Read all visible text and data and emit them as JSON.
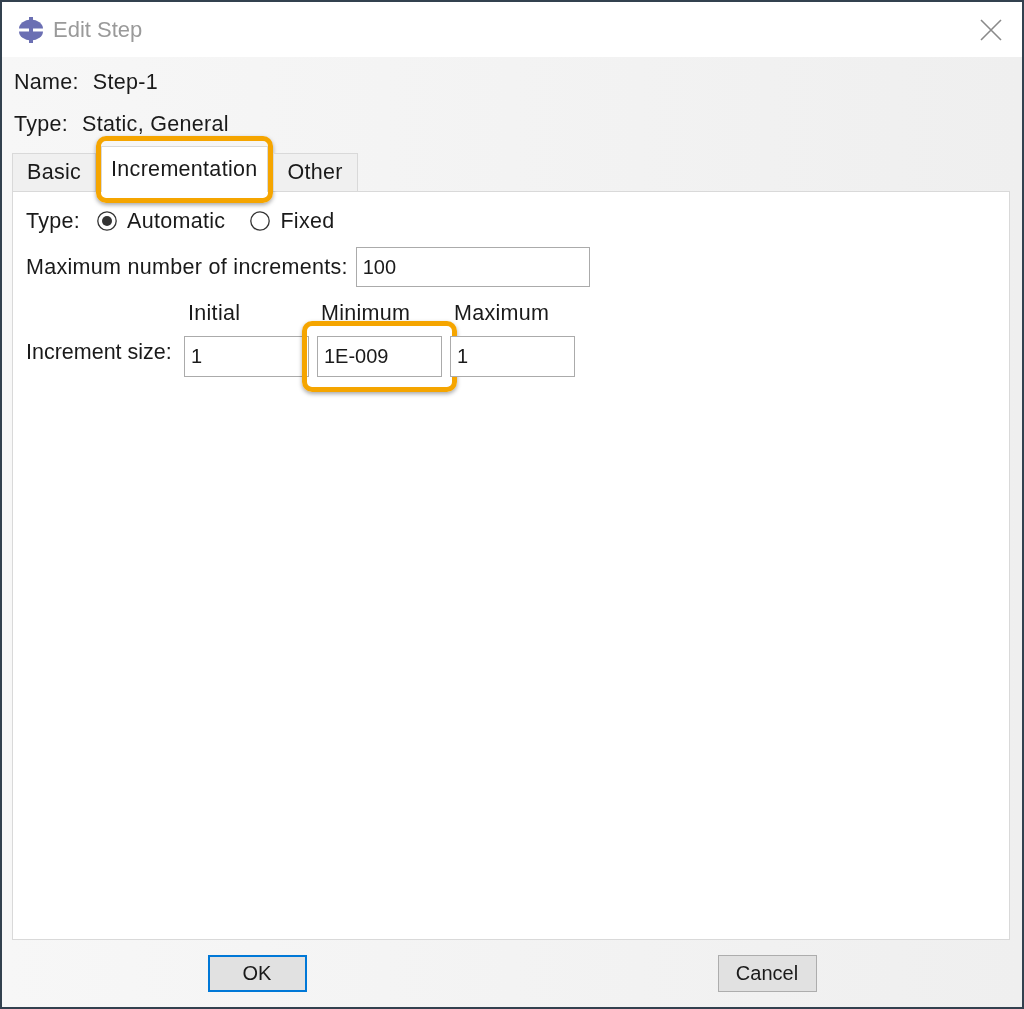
{
  "window": {
    "title": "Edit Step"
  },
  "info": [
    {
      "label": "Name:",
      "value": "Step-1"
    },
    {
      "label": "Type:",
      "value": "Static, General"
    }
  ],
  "tabs": [
    {
      "label": "Basic",
      "selected": false,
      "highlighted": false
    },
    {
      "label": "Incrementation",
      "selected": true,
      "highlighted": true
    },
    {
      "label": "Other",
      "selected": false,
      "highlighted": false
    }
  ],
  "incrementation": {
    "type_label": "Type:",
    "type_options": [
      {
        "label": "Automatic",
        "selected": true
      },
      {
        "label": "Fixed",
        "selected": false
      }
    ],
    "max_increments": {
      "label": "Maximum number of increments:",
      "value": "100"
    },
    "increment_size": {
      "label": "Increment size:",
      "columns": [
        {
          "heading": "Initial",
          "value": "1",
          "highlighted": false
        },
        {
          "heading": "Minimum",
          "value": "1E-009",
          "highlighted": true
        },
        {
          "heading": "Maximum",
          "value": "1",
          "highlighted": false
        }
      ]
    }
  },
  "buttons": [
    {
      "label": "OK",
      "default": true
    },
    {
      "label": "Cancel",
      "default": false
    }
  ]
}
